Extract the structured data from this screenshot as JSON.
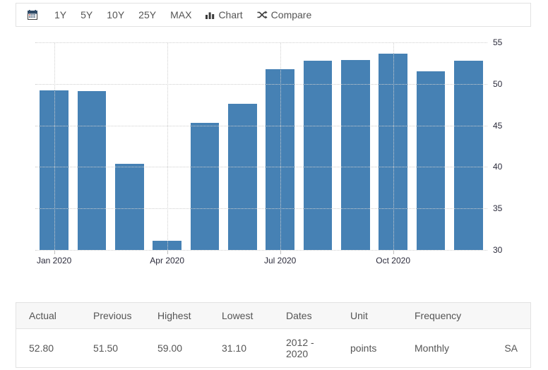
{
  "toolbar": {
    "calendar_icon": "calendar-icon",
    "ranges": [
      {
        "label": "1Y"
      },
      {
        "label": "5Y"
      },
      {
        "label": "10Y"
      },
      {
        "label": "25Y"
      },
      {
        "label": "MAX"
      }
    ],
    "chart": {
      "label": "Chart",
      "icon": "bar-chart-icon"
    },
    "compare": {
      "label": "Compare",
      "icon": "shuffle-icon"
    }
  },
  "chart_data": {
    "type": "bar",
    "title": "",
    "xlabel": "",
    "ylabel": "",
    "grid": true,
    "legend": "none",
    "bar_color": "#4681b4",
    "ylim": [
      30,
      55
    ],
    "yticks": [
      30,
      35,
      40,
      45,
      50,
      55
    ],
    "categories": [
      "Jan 2020",
      "Feb 2020",
      "Mar 2020",
      "Apr 2020",
      "May 2020",
      "Jun 2020",
      "Jul 2020",
      "Aug 2020",
      "Sep 2020",
      "Oct 2020",
      "Nov 2020",
      "Dec 2020"
    ],
    "xtick_labels": [
      "Jan 2020",
      "Apr 2020",
      "Jul 2020",
      "Oct 2020"
    ],
    "xtick_indices": [
      0,
      3,
      6,
      9
    ],
    "values": [
      49.2,
      49.1,
      40.4,
      31.1,
      45.3,
      47.6,
      51.8,
      52.8,
      52.9,
      53.6,
      51.5,
      52.8
    ]
  },
  "table": {
    "headers": [
      "Actual",
      "Previous",
      "Highest",
      "Lowest",
      "Dates",
      "Unit",
      "Frequency",
      ""
    ],
    "row": [
      "52.80",
      "51.50",
      "59.00",
      "31.10",
      "2012 - 2020",
      "points",
      "Monthly",
      "SA"
    ]
  }
}
